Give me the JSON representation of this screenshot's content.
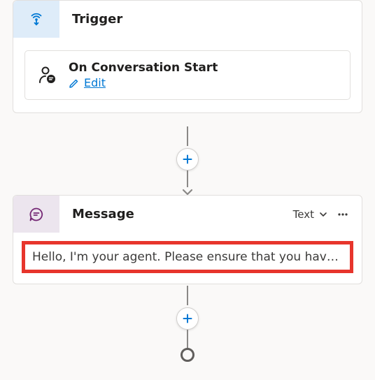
{
  "trigger": {
    "title": "Trigger",
    "action_title": "On Conversation Start",
    "edit_label": "Edit"
  },
  "message": {
    "title": "Message",
    "type_label": "Text",
    "body_text": "Hello, I'm your agent. Please ensure that you have set up your environment correctly before we begin."
  }
}
